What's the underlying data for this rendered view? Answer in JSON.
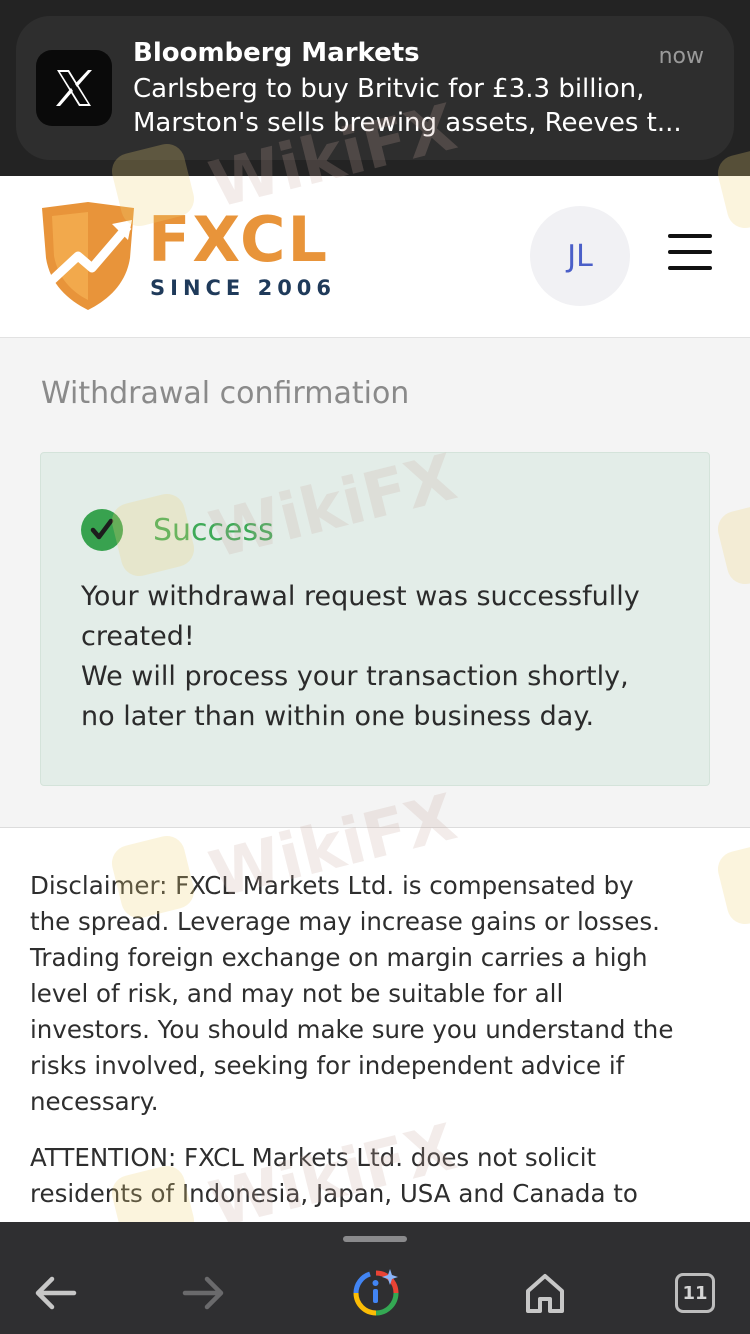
{
  "notification": {
    "app": "Bloomberg Markets",
    "time": "now",
    "line1": "Carlsberg to buy Britvic for £3.3 billion,",
    "line2": "Marston's sells brewing assets, Reeves t..."
  },
  "header": {
    "logo_text": "FXCL",
    "logo_sub": "SINCE 2006",
    "avatar_initials": "JL"
  },
  "panel": {
    "title": "Withdrawal confirmation",
    "status": "Success",
    "message_lines": [
      "Your withdrawal request was successfully",
      "created!",
      "We will process your transaction shortly,",
      "no later than within one business day."
    ]
  },
  "disclaimer_lines": [
    "Disclaimer: FXCL Markets Ltd. is compensated by",
    "the spread. Leverage may increase gains or losses.",
    "Trading foreign exchange on margin carries a high",
    "level of risk, and may not be suitable for all",
    "investors. You should make sure you understand the",
    "risks involved, seeking for independent advice if",
    "necessary."
  ],
  "attention_lines": [
    "ATTENTION: FXCL Markets Ltd. does not solicit",
    "residents of Indonesia, Japan, USA and Canada to"
  ],
  "watermark": "WikiFX",
  "toolbar": {
    "tabs_count": "11"
  },
  "colors": {
    "logo_orange": "#e8943a",
    "logo_navy": "#1f3a5a",
    "success_green": "#3eaa57",
    "alert_bg": "#e3ede8",
    "avatar_text": "#4b5fc8"
  },
  "icons": {
    "notification": "x-logo-icon",
    "status": "checkmark-circle-icon",
    "menu": "hamburger-menu-icon",
    "back": "arrow-left-icon",
    "forward": "arrow-right-icon",
    "assistant": "google-lens-icon",
    "home": "home-icon",
    "tabs": "tabs-icon"
  }
}
